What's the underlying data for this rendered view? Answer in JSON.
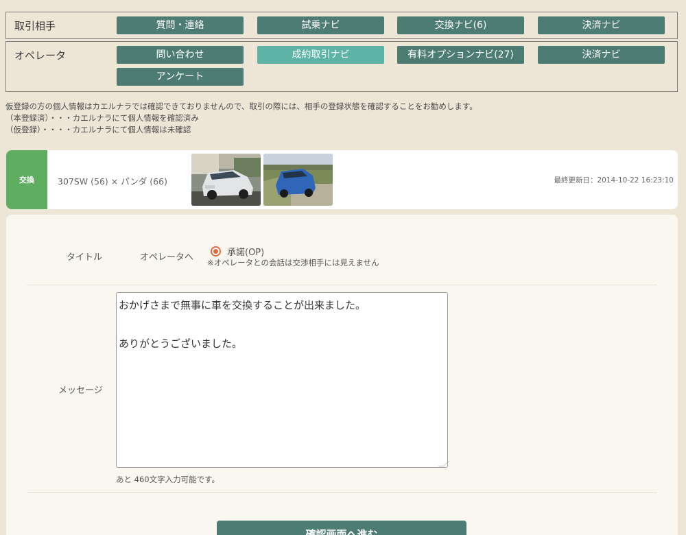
{
  "nav": {
    "partner_row": {
      "label": "取引相手",
      "buttons": [
        "質問・連絡",
        "試乗ナビ",
        "交換ナビ(6)",
        "決済ナビ"
      ]
    },
    "operator_row": {
      "label": "オペレータ",
      "buttons": [
        "問い合わせ",
        "成約取引ナビ",
        "有料オプションナビ(27)",
        "決済ナビ",
        "アンケート"
      ],
      "active_index": 1
    }
  },
  "notice": {
    "line1": "仮登録の方の個人情報はカエルナラでは確認できておりませんので、取引の際には、相手の登録状態を確認することをお勧めします。",
    "line2": "（本登録済）・・・カエルナラにて個人情報を確認済み",
    "line3": "（仮登録）・・・・カエルナラにて個人情報は未確認"
  },
  "trade": {
    "type": "交換",
    "name": "307SW (56) × パンダ (66)",
    "updated": "最終更新日：2014-10-22 16:23:10"
  },
  "form": {
    "title_label": "タイトル",
    "to_label": "オペレータへ",
    "radio_label": "承諾(OP)",
    "operator_note": "※オペレータとの会話は交渉相手には見えません",
    "message_label": "メッセージ",
    "message_value": "おかげさまで無事に車を交換することが出来ました。\n\nありがとうございました。",
    "remaining": "あと 460文字入力可能です。",
    "confirm_label": "確認画面へ進む"
  },
  "colors": {
    "nav_button": "#4d7c73",
    "nav_button_active": "#5cb3a6",
    "trade_badge": "#5fad60",
    "radio_accent": "#e06a3d",
    "page_bg": "#ede6d7"
  }
}
